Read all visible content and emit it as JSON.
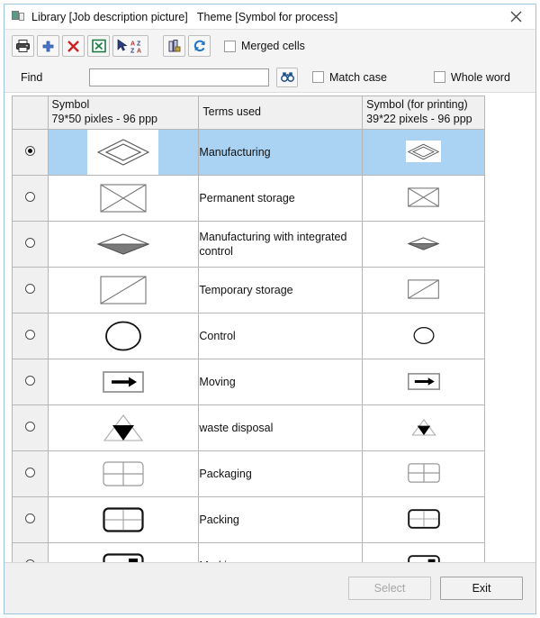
{
  "window": {
    "title": "Library [Job description picture]   Theme [Symbol for process]",
    "close_label": "✕",
    "icon_name": "library-icon"
  },
  "toolbar": {
    "buttons": [
      {
        "name": "print-button",
        "icon": "printer-icon",
        "tooltip": "Print"
      },
      {
        "name": "add-button",
        "icon": "plus-icon",
        "tooltip": "Add"
      },
      {
        "name": "delete-button",
        "icon": "red-x-icon",
        "tooltip": "Delete"
      },
      {
        "name": "export-button",
        "icon": "excel-icon",
        "tooltip": "Export to Excel"
      },
      {
        "name": "sort-button",
        "icon": "sort-az-icon",
        "tooltip": "Sort"
      },
      {
        "name": "columns-button",
        "icon": "columns-icon",
        "tooltip": "Columns"
      },
      {
        "name": "refresh-button",
        "icon": "refresh-icon",
        "tooltip": "Refresh"
      }
    ],
    "merged_cells_label": "Merged cells",
    "merged_cells_checked": false
  },
  "find": {
    "label": "Find",
    "value": "",
    "placeholder": "",
    "search_icon": "binoculars-icon",
    "match_case_label": "Match case",
    "match_case_checked": false,
    "whole_word_label": "Whole word",
    "whole_word_checked": false
  },
  "grid": {
    "headers": {
      "radio": "",
      "symbol_line1": "Symbol",
      "symbol_line2": "79*50 pixles - 96 ppp",
      "terms": "Terms used",
      "print_line1": "Symbol (for printing)",
      "print_line2": "39*22 pixels - 96 ppp"
    },
    "rows": [
      {
        "term": "Manufacturing",
        "symbol": "diamond-outline-icon",
        "selected": true
      },
      {
        "term": "Permanent storage",
        "symbol": "rect-with-x-icon",
        "selected": false
      },
      {
        "term": "Manufacturing with integrated control",
        "symbol": "diamond-half-filled-icon",
        "selected": false
      },
      {
        "term": "Temporary storage",
        "symbol": "rect-with-diagonal-icon",
        "selected": false
      },
      {
        "term": "Control",
        "symbol": "circle-outline-icon",
        "selected": false
      },
      {
        "term": "Moving",
        "symbol": "rect-with-arrow-icon",
        "selected": false
      },
      {
        "term": "waste disposal",
        "symbol": "triangle-with-filled-triangle-icon",
        "selected": false
      },
      {
        "term": "Packaging",
        "symbol": "rect-quadrants-thin-icon",
        "selected": false
      },
      {
        "term": "Packing",
        "symbol": "rect-quadrants-bold-icon",
        "selected": false
      },
      {
        "term": "Marking",
        "symbol": "rect-with-black-square-icon",
        "selected": false
      }
    ]
  },
  "footer": {
    "select_label": "Select",
    "select_disabled": true,
    "exit_label": "Exit",
    "exit_disabled": false
  },
  "colors": {
    "selection": "#a9d2f3",
    "window_border": "#9fc6e0",
    "toolbar_bg": "#f4f4f4",
    "header_bg": "#f0f0f0",
    "grid_line": "#b6b6b6"
  }
}
